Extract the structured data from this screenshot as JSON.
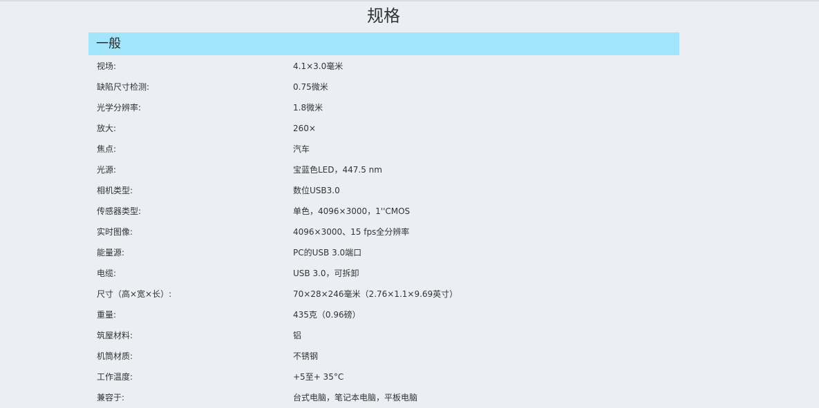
{
  "page": {
    "title": "规格"
  },
  "section": {
    "title": "一般"
  },
  "specs": [
    {
      "label": "视场:",
      "value": "4.1×3.0毫米"
    },
    {
      "label": "缺陷尺寸检测:",
      "value": "0.75微米"
    },
    {
      "label": "光学分辨率:",
      "value": "1.8微米"
    },
    {
      "label": "放大:",
      "value": "260×"
    },
    {
      "label": "焦点:",
      "value": "汽车"
    },
    {
      "label": "光源:",
      "value": "宝蓝色LED，447.5 nm"
    },
    {
      "label": "相机类型:",
      "value": "数位USB3.0"
    },
    {
      "label": "传感器类型:",
      "value": "单色，4096×3000，1''CMOS"
    },
    {
      "label": "实时图像:",
      "value": "4096×3000、15 fps全分辨率"
    },
    {
      "label": "能量源:",
      "value": "PC的USB 3.0端口"
    },
    {
      "label": "电缆:",
      "value": "USB 3.0，可拆卸"
    },
    {
      "label": "尺寸（高×宽×长）:",
      "value": "70×28×246毫米（2.76×1.1×9.69英寸）"
    },
    {
      "label": "重量:",
      "value": "435克（0.96磅）"
    },
    {
      "label": "筑屋材料:",
      "value": "铝"
    },
    {
      "label": "机筒材质:",
      "value": "不锈钢"
    },
    {
      "label": "工作温度:",
      "value": "+5至+ 35°C"
    },
    {
      "label": "兼容于:",
      "value": "台式电脑，笔记本电脑，平板电脑"
    }
  ],
  "colors": {
    "background": "#ebeef2",
    "section_bar": "#a3e6fc",
    "text": "#333333"
  }
}
